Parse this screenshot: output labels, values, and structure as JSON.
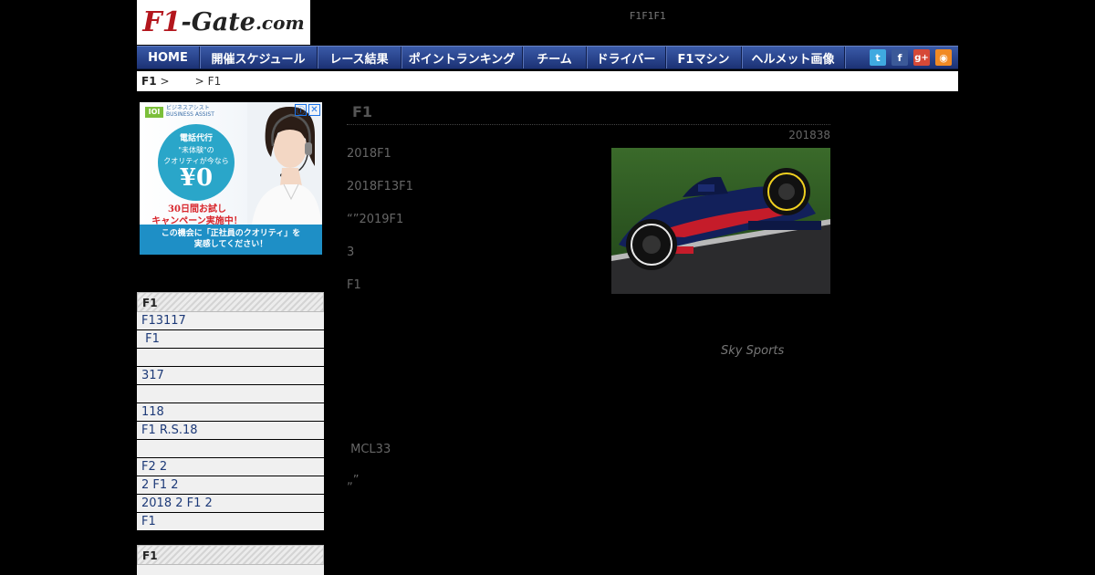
{
  "header": {
    "logo": {
      "part1": "F1",
      "part2": "-Gate",
      "part3": ".com"
    },
    "tagline": "F1F1F1"
  },
  "nav": {
    "items": [
      {
        "label": "HOME"
      },
      {
        "label": "開催スケジュール"
      },
      {
        "label": "レース結果"
      },
      {
        "label": "ポイントランキング"
      },
      {
        "label": "チーム"
      },
      {
        "label": "ドライバー"
      },
      {
        "label": "F1マシン"
      },
      {
        "label": "ヘルメット画像"
      }
    ],
    "social": [
      {
        "icon": "twitter-icon",
        "glyph": "t"
      },
      {
        "icon": "facebook-icon",
        "glyph": "f"
      },
      {
        "icon": "google-plus-icon",
        "glyph": "g+"
      },
      {
        "icon": "rss-icon",
        "glyph": "◉"
      }
    ]
  },
  "breadcrumb": {
    "home": "F1",
    "sep1": ">",
    "middle": "",
    "sep2": ">",
    "current": "F1"
  },
  "ad": {
    "brand_mark": "IOI",
    "brand_line1": "ビジネスアシスト",
    "brand_line2": "BUSINESS ASSIST",
    "circle_line1": "電話代行",
    "circle_line2": "\"未体験\"の",
    "circle_line3": "クオリティが今なら",
    "circle_price": "¥0",
    "campaign_line1": "30日間お試し",
    "campaign_line2": "キャンペーン実施中！",
    "bottom_line1": "この機会に「正社員のクオリティ」を",
    "bottom_line2": "実感してください！",
    "info_glyph": "ⓘ",
    "close_glyph": "✕"
  },
  "sidebar": {
    "box1": {
      "title": "F1",
      "items": [
        "F13117",
        " F1",
        "",
        "317",
        "",
        "118",
        "F1 R.S.18",
        "",
        "F2 2",
        "2 F1 2",
        "2018 2 F1 2",
        "F1"
      ]
    },
    "box2": {
      "title": "F1"
    }
  },
  "article": {
    "title": "F1",
    "date": "201838",
    "paragraphs": [
      "2018F1",
      "2018F13F1",
      "“”2019F1",
      "3",
      "F1"
    ],
    "photo_credit": "Sky Sports",
    "para_mcl": " MCL33",
    "para_quote": "„”"
  },
  "colors": {
    "nav_top": "#3a5aa8",
    "nav_bottom": "#1c3275",
    "logo_red": "#b3161d",
    "link_blue": "#1d3a78"
  }
}
